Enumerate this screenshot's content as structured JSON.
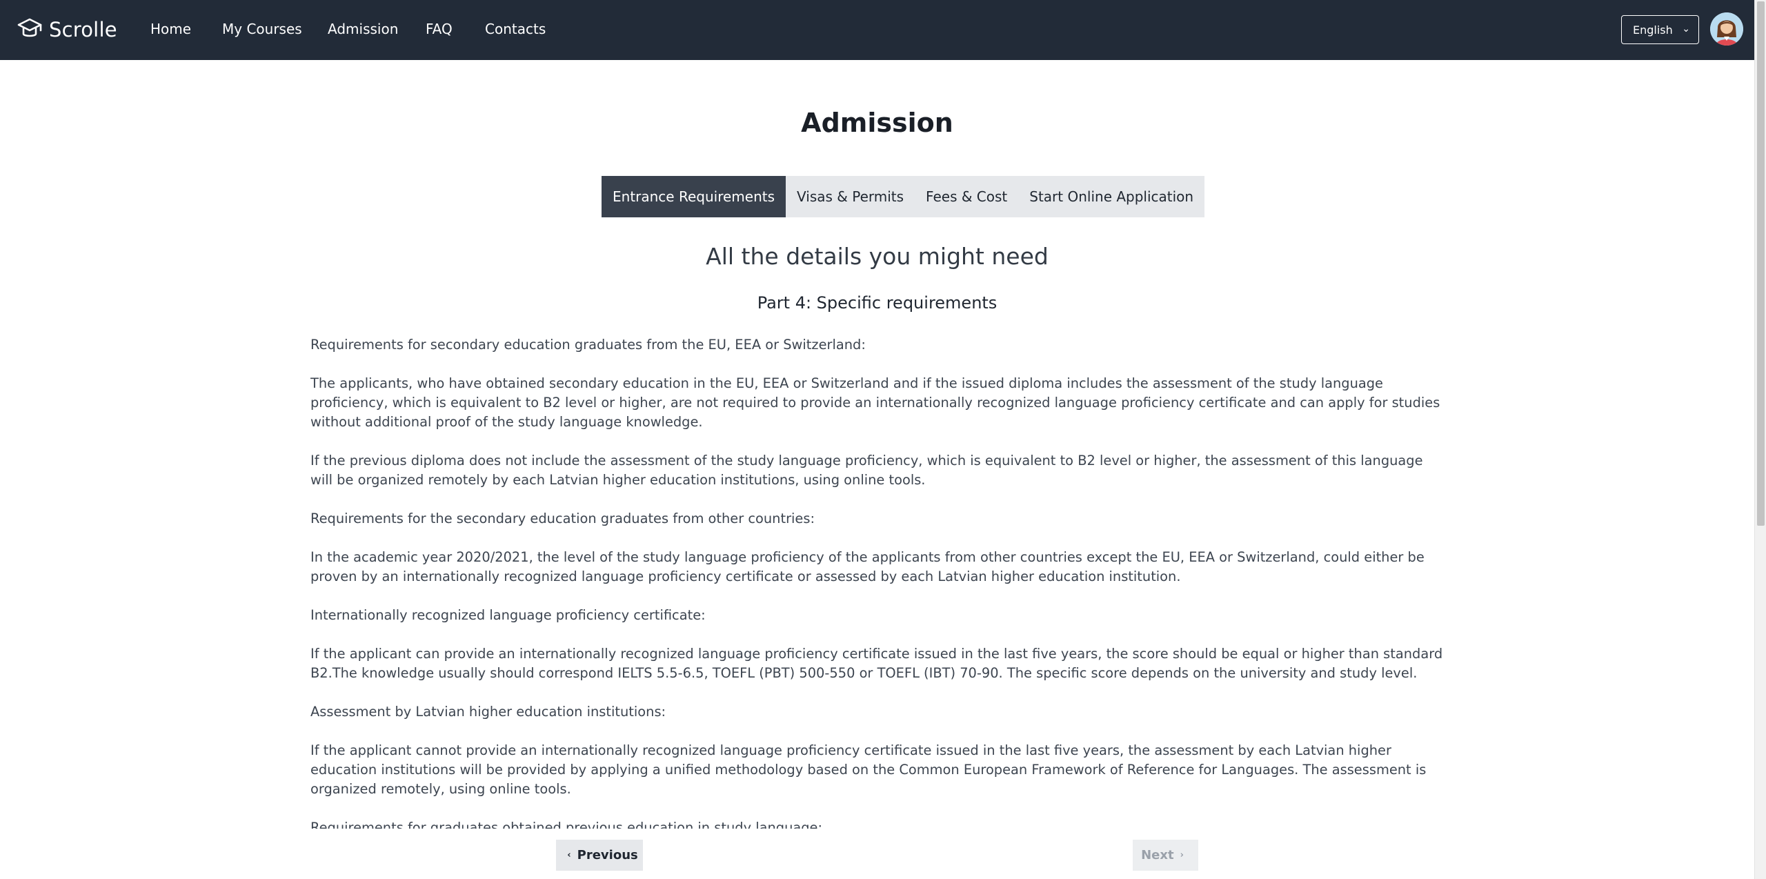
{
  "brand": {
    "name": "Scrolle",
    "logo_icon": "graduation-cap-icon"
  },
  "nav": {
    "items": [
      {
        "label": "Home"
      },
      {
        "label": "My Courses"
      },
      {
        "label": "Admission"
      },
      {
        "label": "FAQ"
      },
      {
        "label": "Contacts"
      }
    ],
    "language": "English",
    "avatar_icon": "user-avatar"
  },
  "page": {
    "title": "Admission",
    "tabs": [
      {
        "label": "Entrance Requirements",
        "active": true
      },
      {
        "label": "Visas & Permits",
        "active": false
      },
      {
        "label": "Fees & Cost",
        "active": false
      },
      {
        "label": "Start Online Application",
        "active": false
      }
    ],
    "subtitle": "All the details you might need",
    "part_title": "Part 4: Specific requirements",
    "paragraphs": [
      "Requirements for secondary education graduates from the EU, EEA or Switzerland:",
      "The applicants, who have obtained secondary education in the EU, EEA or Switzerland and if the issued diploma includes the assessment of the study language proficiency, which is equivalent to B2 level or higher, are not required to provide an internationally recognized language proficiency certificate and can apply for studies without additional proof of the study language knowledge.",
      "If the previous diploma does not include the assessment of the study language proficiency, which is equivalent to B2 level or higher, the assessment of this language will be organized remotely by each Latvian higher education institutions, using online tools.",
      "Requirements for the secondary education graduates from other countries:",
      "In the academic year 2020/2021, the level of the study language proficiency of the applicants from other countries except the EU, EEA or Switzerland, could either be proven by an internationally recognized language proficiency certificate or assessed by each Latvian higher education institution.",
      "Internationally recognized language proficiency certificate:",
      "If the applicant can provide an internationally recognized language proficiency certificate issued in the last five years, the score should be equal or higher than standard B2.The knowledge usually should correspond IELTS 5.5-6.5, TOEFL (PBT) 500-550 or TOEFL (IBT) 70-90. The specific score depends on the university and study level.",
      "Assessment by Latvian higher education institutions:",
      "If the applicant cannot provide an internationally recognized language proficiency certificate issued in the last five years, the assessment by each Latvian higher education institutions will be provided by applying a unified methodology based on the Common European Framework of Reference for Languages. The assessment is organized remotely, using online tools.",
      "Requirements for graduates obtained previous education in study language:"
    ]
  },
  "pager": {
    "previous": "Previous",
    "next": "Next"
  },
  "colors": {
    "topbar": "#222b38",
    "active_tab": "#39414d",
    "tab_bg": "#e6e8eb"
  }
}
